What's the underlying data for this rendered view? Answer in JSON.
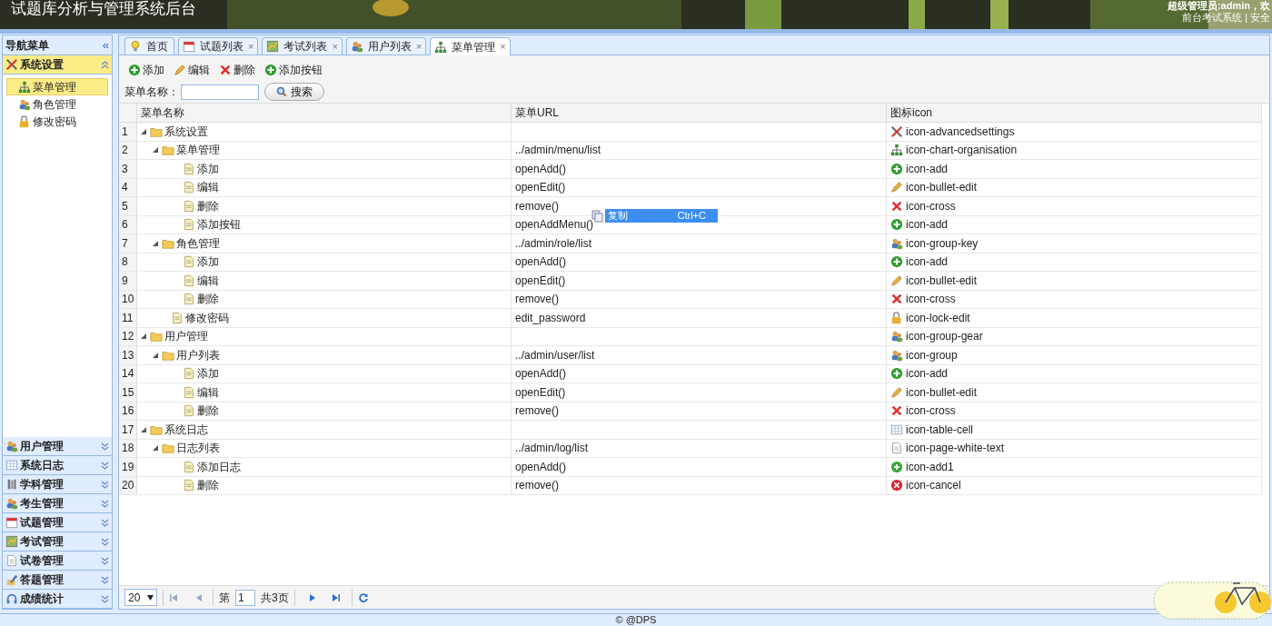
{
  "header": {
    "title": "试题库分析与管理系统后台",
    "user_line": "超级管理员:admin，欢",
    "links": [
      "前台考试系统",
      "安全"
    ],
    "separator": "|"
  },
  "sidebar": {
    "title": "导航菜单",
    "collapse_glyph": "«",
    "sections": [
      {
        "label": "系统设置",
        "kind": "tools",
        "expanded": true,
        "items": [
          {
            "label": "菜单管理",
            "kind": "org",
            "selected": true
          },
          {
            "label": "角色管理",
            "kind": "groupkey",
            "selected": false
          },
          {
            "label": "修改密码",
            "kind": "lock",
            "selected": false
          }
        ]
      },
      {
        "label": "用户管理",
        "kind": "groupgear",
        "expanded": false
      },
      {
        "label": "系统日志",
        "kind": "table",
        "expanded": false
      },
      {
        "label": "学科管理",
        "kind": "book",
        "expanded": false
      },
      {
        "label": "考生管理",
        "kind": "group",
        "expanded": false
      },
      {
        "label": "试题管理",
        "kind": "calendar",
        "expanded": false
      },
      {
        "label": "考试管理",
        "kind": "map",
        "expanded": false
      },
      {
        "label": "试卷管理",
        "kind": "page",
        "expanded": false
      },
      {
        "label": "答题管理",
        "kind": "pen",
        "expanded": false
      },
      {
        "label": "成绩统计",
        "kind": "headset",
        "expanded": false
      }
    ]
  },
  "tabs": [
    {
      "label": "首页",
      "kind": "bulb",
      "closable": false,
      "selected": false
    },
    {
      "label": "试题列表",
      "kind": "calendar",
      "closable": true,
      "selected": false
    },
    {
      "label": "考试列表",
      "kind": "map",
      "closable": true,
      "selected": false
    },
    {
      "label": "用户列表",
      "kind": "group",
      "closable": true,
      "selected": false
    },
    {
      "label": "菜单管理",
      "kind": "org",
      "closable": true,
      "selected": true
    }
  ],
  "close_glyph": "×",
  "toolbar": [
    {
      "label": "添加",
      "kind": "add"
    },
    {
      "label": "编辑",
      "kind": "edit"
    },
    {
      "label": "删除",
      "kind": "cross"
    },
    {
      "label": "添加按钮",
      "kind": "add"
    }
  ],
  "search": {
    "label": "菜单名称：",
    "button": "搜索"
  },
  "table": {
    "columns": [
      "菜单名称",
      "菜单URL",
      "图标icon"
    ],
    "rows": [
      {
        "no": "1",
        "name": "系统设置",
        "url": "",
        "kind": "tools",
        "icon_text": "icon-advancedsettings",
        "expanded": true,
        "children": [
          {
            "no": "2",
            "name": "菜单管理",
            "url": "../admin/menu/list",
            "kind": "org",
            "icon_text": "icon-chart-organisation",
            "expanded": true,
            "children": [
              {
                "no": "3",
                "name": "添加",
                "url": "openAdd()",
                "kind": "add",
                "icon_text": "icon-add"
              },
              {
                "no": "4",
                "name": "编辑",
                "url": "openEdit()",
                "kind": "edit",
                "icon_text": "icon-bullet-edit"
              },
              {
                "no": "5",
                "name": "删除",
                "url": "remove()",
                "kind": "cross",
                "icon_text": "icon-cross"
              },
              {
                "no": "6",
                "name": "添加按钮",
                "url": "openAddMenu()",
                "kind": "add",
                "icon_text": "icon-add"
              }
            ]
          },
          {
            "no": "7",
            "name": "角色管理",
            "url": "../admin/role/list",
            "kind": "groupkey",
            "icon_text": "icon-group-key",
            "expanded": true,
            "children": [
              {
                "no": "8",
                "name": "添加",
                "url": "openAdd()",
                "kind": "add",
                "icon_text": "icon-add"
              },
              {
                "no": "9",
                "name": "编辑",
                "url": "openEdit()",
                "kind": "edit",
                "icon_text": "icon-bullet-edit"
              },
              {
                "no": "10",
                "name": "删除",
                "url": "remove()",
                "kind": "cross",
                "icon_text": "icon-cross"
              }
            ]
          },
          {
            "no": "11",
            "name": "修改密码",
            "url": "edit_password",
            "kind": "lock",
            "icon_text": "icon-lock-edit"
          }
        ]
      },
      {
        "no": "12",
        "name": "用户管理",
        "url": "",
        "kind": "groupgear",
        "icon_text": "icon-group-gear",
        "expanded": true,
        "children": [
          {
            "no": "13",
            "name": "用户列表",
            "url": "../admin/user/list",
            "kind": "group",
            "icon_text": "icon-group",
            "expanded": true,
            "children": [
              {
                "no": "14",
                "name": "添加",
                "url": "openAdd()",
                "kind": "add",
                "icon_text": "icon-add"
              },
              {
                "no": "15",
                "name": "编辑",
                "url": "openEdit()",
                "kind": "edit",
                "icon_text": "icon-bullet-edit"
              },
              {
                "no": "16",
                "name": "删除",
                "url": "remove()",
                "kind": "cross",
                "icon_text": "icon-cross"
              }
            ]
          }
        ]
      },
      {
        "no": "17",
        "name": "系统日志",
        "url": "",
        "kind": "table",
        "icon_text": "icon-table-cell",
        "expanded": true,
        "children": [
          {
            "no": "18",
            "name": "日志列表",
            "url": "../admin/log/list",
            "kind": "page",
            "icon_text": "icon-page-white-text",
            "expanded": true,
            "children": [
              {
                "no": "19",
                "name": "添加日志",
                "url": "openAdd()",
                "kind": "add1",
                "icon_text": "icon-add1"
              },
              {
                "no": "20",
                "name": "删除",
                "url": "remove()",
                "kind": "cancel",
                "icon_text": "icon-cancel"
              }
            ]
          }
        ]
      }
    ]
  },
  "context_menu": {
    "label": "复制",
    "shortcut": "Ctrl+C"
  },
  "pager": {
    "page_size": "20",
    "prefix": "第",
    "page": "1",
    "total": "共3页"
  },
  "footer": "© @DPS"
}
